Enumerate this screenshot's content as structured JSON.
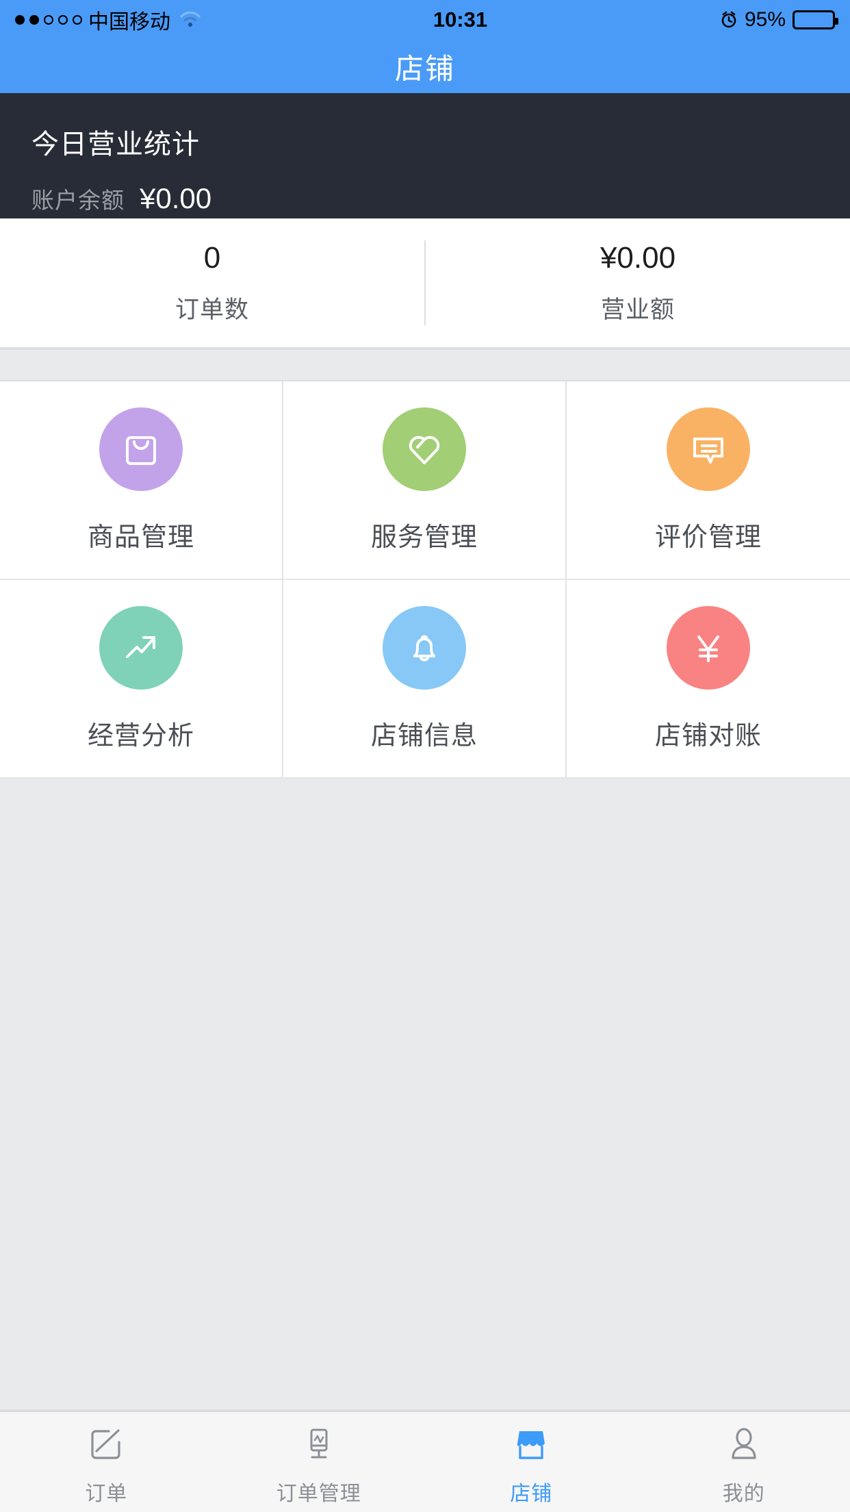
{
  "statusbar": {
    "carrier": "中国移动",
    "signal_dots_filled": 2,
    "signal_dots_total": 5,
    "wifi_icon": "wifi-icon",
    "time": "10:31",
    "alarm_icon": "alarm-clock-icon",
    "battery_percent": "95%",
    "battery_level": 95
  },
  "navbar": {
    "title": "店铺"
  },
  "banner": {
    "title": "今日营业统计",
    "balance_label": "账户余额",
    "balance_value": "¥0.00",
    "background_color": "#272c36"
  },
  "stats": [
    {
      "value": "0",
      "label": "订单数"
    },
    {
      "value": "¥0.00",
      "label": "营业额"
    }
  ],
  "grid": [
    {
      "label": "商品管理",
      "icon": "shopping-bag-icon",
      "color": "#c2a3ea"
    },
    {
      "label": "服务管理",
      "icon": "heart-icon",
      "color": "#a2ce75"
    },
    {
      "label": "评价管理",
      "icon": "chat-bubble-icon",
      "color": "#f9b264"
    },
    {
      "label": "经营分析",
      "icon": "trending-up-icon",
      "color": "#7fd2b7"
    },
    {
      "label": "店铺信息",
      "icon": "bell-icon",
      "color": "#87c8f7"
    },
    {
      "label": "店铺对账",
      "icon": "yen-icon",
      "color": "#f98382"
    }
  ],
  "tabbar": {
    "active_color": "#3d9bfa",
    "inactive_color": "#8b8f96",
    "items": [
      {
        "label": "订单",
        "icon": "compose-edit-icon",
        "active": false
      },
      {
        "label": "订单管理",
        "icon": "monitor-chart-icon",
        "active": false
      },
      {
        "label": "店铺",
        "icon": "storefront-icon",
        "active": true
      },
      {
        "label": "我的",
        "icon": "person-icon",
        "active": false
      }
    ]
  },
  "theme": {
    "accent": "#4a9bf7",
    "page_background": "#e9eaec"
  }
}
